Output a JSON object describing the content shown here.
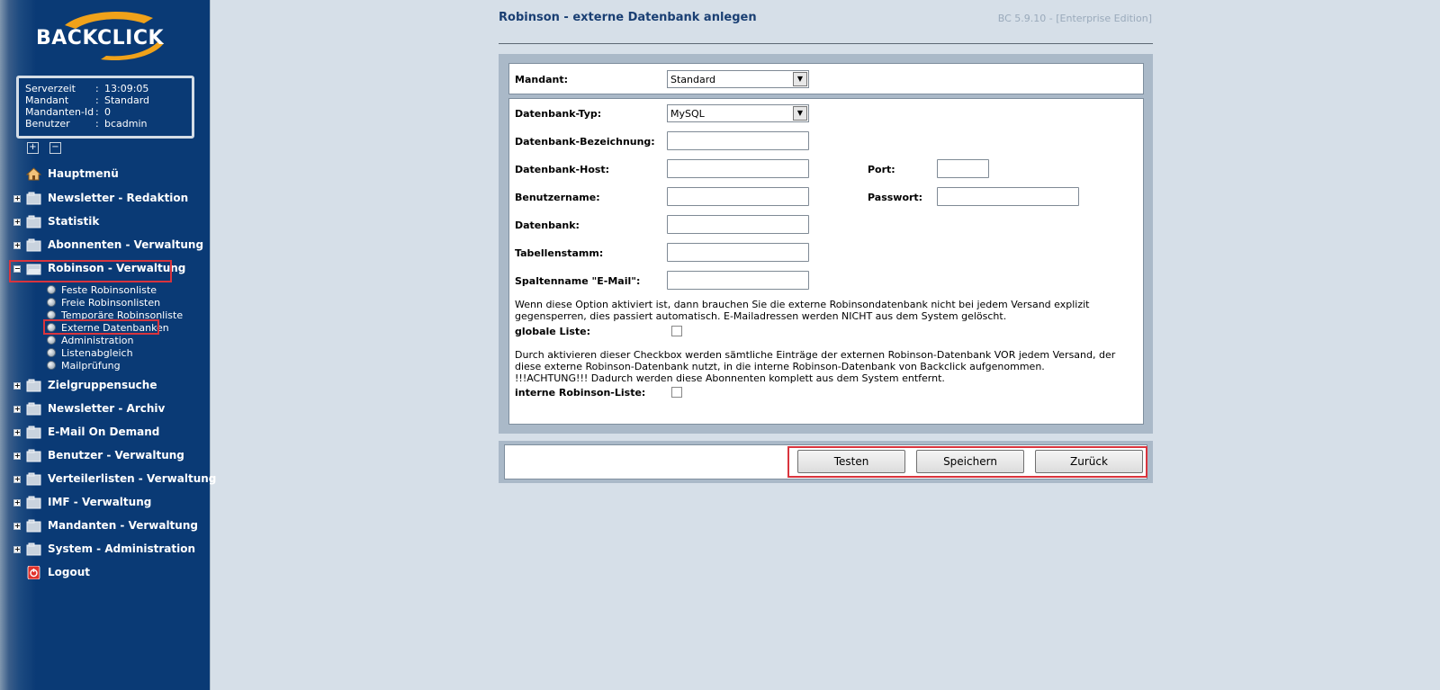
{
  "logo": {
    "text": "BACKCLICK"
  },
  "server_info": {
    "rows": [
      {
        "key": "Serverzeit",
        "value": "13:09:05"
      },
      {
        "key": "Mandant",
        "value": "Standard"
      },
      {
        "key": "Mandanten-Id",
        "value": "0"
      },
      {
        "key": "Benutzer",
        "value": "bcadmin"
      }
    ],
    "separator": ":"
  },
  "tree_controls": {
    "expand": "+",
    "collapse": "−"
  },
  "nav": {
    "items": [
      {
        "label": "Hauptmenü",
        "icon": "home-icon"
      },
      {
        "label": "Newsletter - Redaktion",
        "icon": "folder-icon",
        "expander": "+"
      },
      {
        "label": "Statistik",
        "icon": "folder-icon",
        "expander": "+"
      },
      {
        "label": "Abonnenten - Verwaltung",
        "icon": "folder-icon",
        "expander": "+"
      },
      {
        "label": "Robinson - Verwaltung",
        "icon": "folder-open-icon",
        "expander": "−"
      },
      {
        "label": "Zielgruppensuche",
        "icon": "folder-icon",
        "expander": "+"
      },
      {
        "label": "Newsletter - Archiv",
        "icon": "folder-icon",
        "expander": "+"
      },
      {
        "label": "E-Mail On Demand",
        "icon": "folder-icon",
        "expander": "+"
      },
      {
        "label": "Benutzer - Verwaltung",
        "icon": "folder-icon",
        "expander": "+"
      },
      {
        "label": "Verteilerlisten - Verwaltung",
        "icon": "folder-icon",
        "expander": "+"
      },
      {
        "label": "IMF - Verwaltung",
        "icon": "folder-icon",
        "expander": "+"
      },
      {
        "label": "Mandanten - Verwaltung",
        "icon": "folder-icon",
        "expander": "+"
      },
      {
        "label": "System - Administration",
        "icon": "folder-icon",
        "expander": "+"
      },
      {
        "label": "Logout",
        "icon": "logout-icon"
      }
    ],
    "robinson_sub": [
      "Feste Robinsonliste",
      "Freie Robinsonlisten",
      "Temporäre Robinsonliste",
      "Externe Datenbanken",
      "Administration",
      "Listenabgleich",
      "Mailprüfung"
    ]
  },
  "header": {
    "title": "Robinson - externe Datenbank anlegen",
    "version": "BC 5.9.10 - [Enterprise Edition]"
  },
  "form": {
    "mandant_label": "Mandant:",
    "mandant_value": "Standard",
    "dbtype_label": "Datenbank-Typ:",
    "dbtype_value": "MySQL",
    "dbname_label": "Datenbank-Bezeichnung:",
    "host_label": "Datenbank-Host:",
    "port_label": "Port:",
    "user_label": "Benutzername:",
    "password_label": "Passwort:",
    "db_label": "Datenbank:",
    "table_label": "Tabellenstamm:",
    "column_label": "Spaltenname \"E-Mail\":",
    "global_note": "Wenn diese Option aktiviert ist, dann brauchen Sie die externe Robinsondatenbank nicht bei jedem Versand explizit gegensperren, dies passiert automatisch. E-Mailadressen werden NICHT aus dem System gelöscht.",
    "global_label": "globale Liste:",
    "internal_note_1": "Durch aktivieren dieser Checkbox werden sämtliche Einträge der externen Robinson-Datenbank VOR jedem Versand, der diese externe Robinson-Datenbank nutzt, in die interne Robinson-Datenbank von Backclick aufgenommen.",
    "internal_note_2": "!!!ACHTUNG!!! Dadurch werden diese Abonnenten komplett aus dem System entfernt.",
    "internal_label": "interne Robinson-Liste:"
  },
  "buttons": {
    "test": "Testen",
    "save": "Speichern",
    "back": "Zurück"
  },
  "colors": {
    "highlight": "#d9343d",
    "sidebar": "#0a3a75",
    "title": "#1a3f73"
  }
}
